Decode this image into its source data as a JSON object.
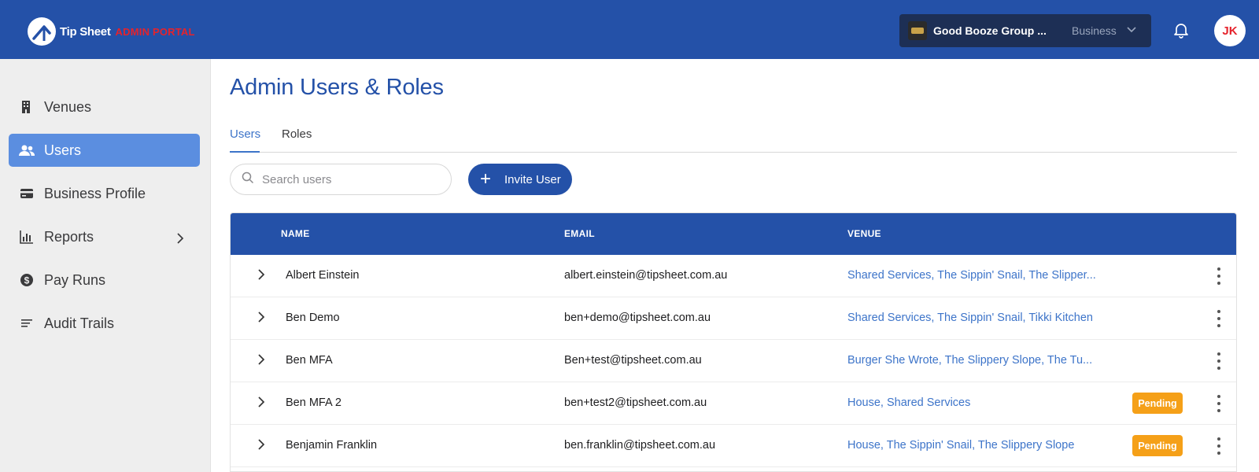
{
  "header": {
    "logo_text": "Tip Sheet",
    "logo_sub": "ADMIN PORTAL",
    "business_name": "Good Booze Group ...",
    "business_type": "Business",
    "avatar_initials": "JK"
  },
  "sidebar": {
    "items": [
      {
        "label": "Venues",
        "icon": "building-icon"
      },
      {
        "label": "Users",
        "icon": "users-icon",
        "active": true
      },
      {
        "label": "Business Profile",
        "icon": "card-icon"
      },
      {
        "label": "Reports",
        "icon": "chart-icon",
        "has_submenu": true
      },
      {
        "label": "Pay Runs",
        "icon": "dollar-icon"
      },
      {
        "label": "Audit Trails",
        "icon": "list-icon"
      }
    ]
  },
  "page": {
    "title": "Admin Users & Roles",
    "tabs": [
      {
        "label": "Users",
        "active": true
      },
      {
        "label": "Roles"
      }
    ],
    "search_placeholder": "Search users",
    "invite_label": "Invite User"
  },
  "table": {
    "columns": [
      "NAME",
      "EMAIL",
      "VENUE"
    ],
    "rows": [
      {
        "name": "Albert Einstein",
        "email": "albert.einstein@tipsheet.com.au",
        "venue": "Shared Services, The Sippin' Snail, The Slipper...",
        "status": ""
      },
      {
        "name": "Ben Demo",
        "email": "ben+demo@tipsheet.com.au",
        "venue": "Shared Services, The Sippin' Snail, Tikki Kitchen",
        "status": ""
      },
      {
        "name": "Ben MFA",
        "email": "Ben+test@tipsheet.com.au",
        "venue": "Burger She Wrote, The Slippery Slope, The Tu...",
        "status": ""
      },
      {
        "name": "Ben MFA 2",
        "email": "ben+test2@tipsheet.com.au",
        "venue": "House, Shared Services",
        "status": "Pending"
      },
      {
        "name": "Benjamin Franklin",
        "email": "ben.franklin@tipsheet.com.au",
        "venue": "House, The Sippin' Snail, The Slippery Slope",
        "status": "Pending"
      }
    ]
  },
  "colors": {
    "brand_blue": "#2451a8",
    "active_nav": "#5b8ee0",
    "link_blue": "#3d74c9",
    "pending_orange": "#f5a018",
    "accent_red": "#e5232c"
  }
}
